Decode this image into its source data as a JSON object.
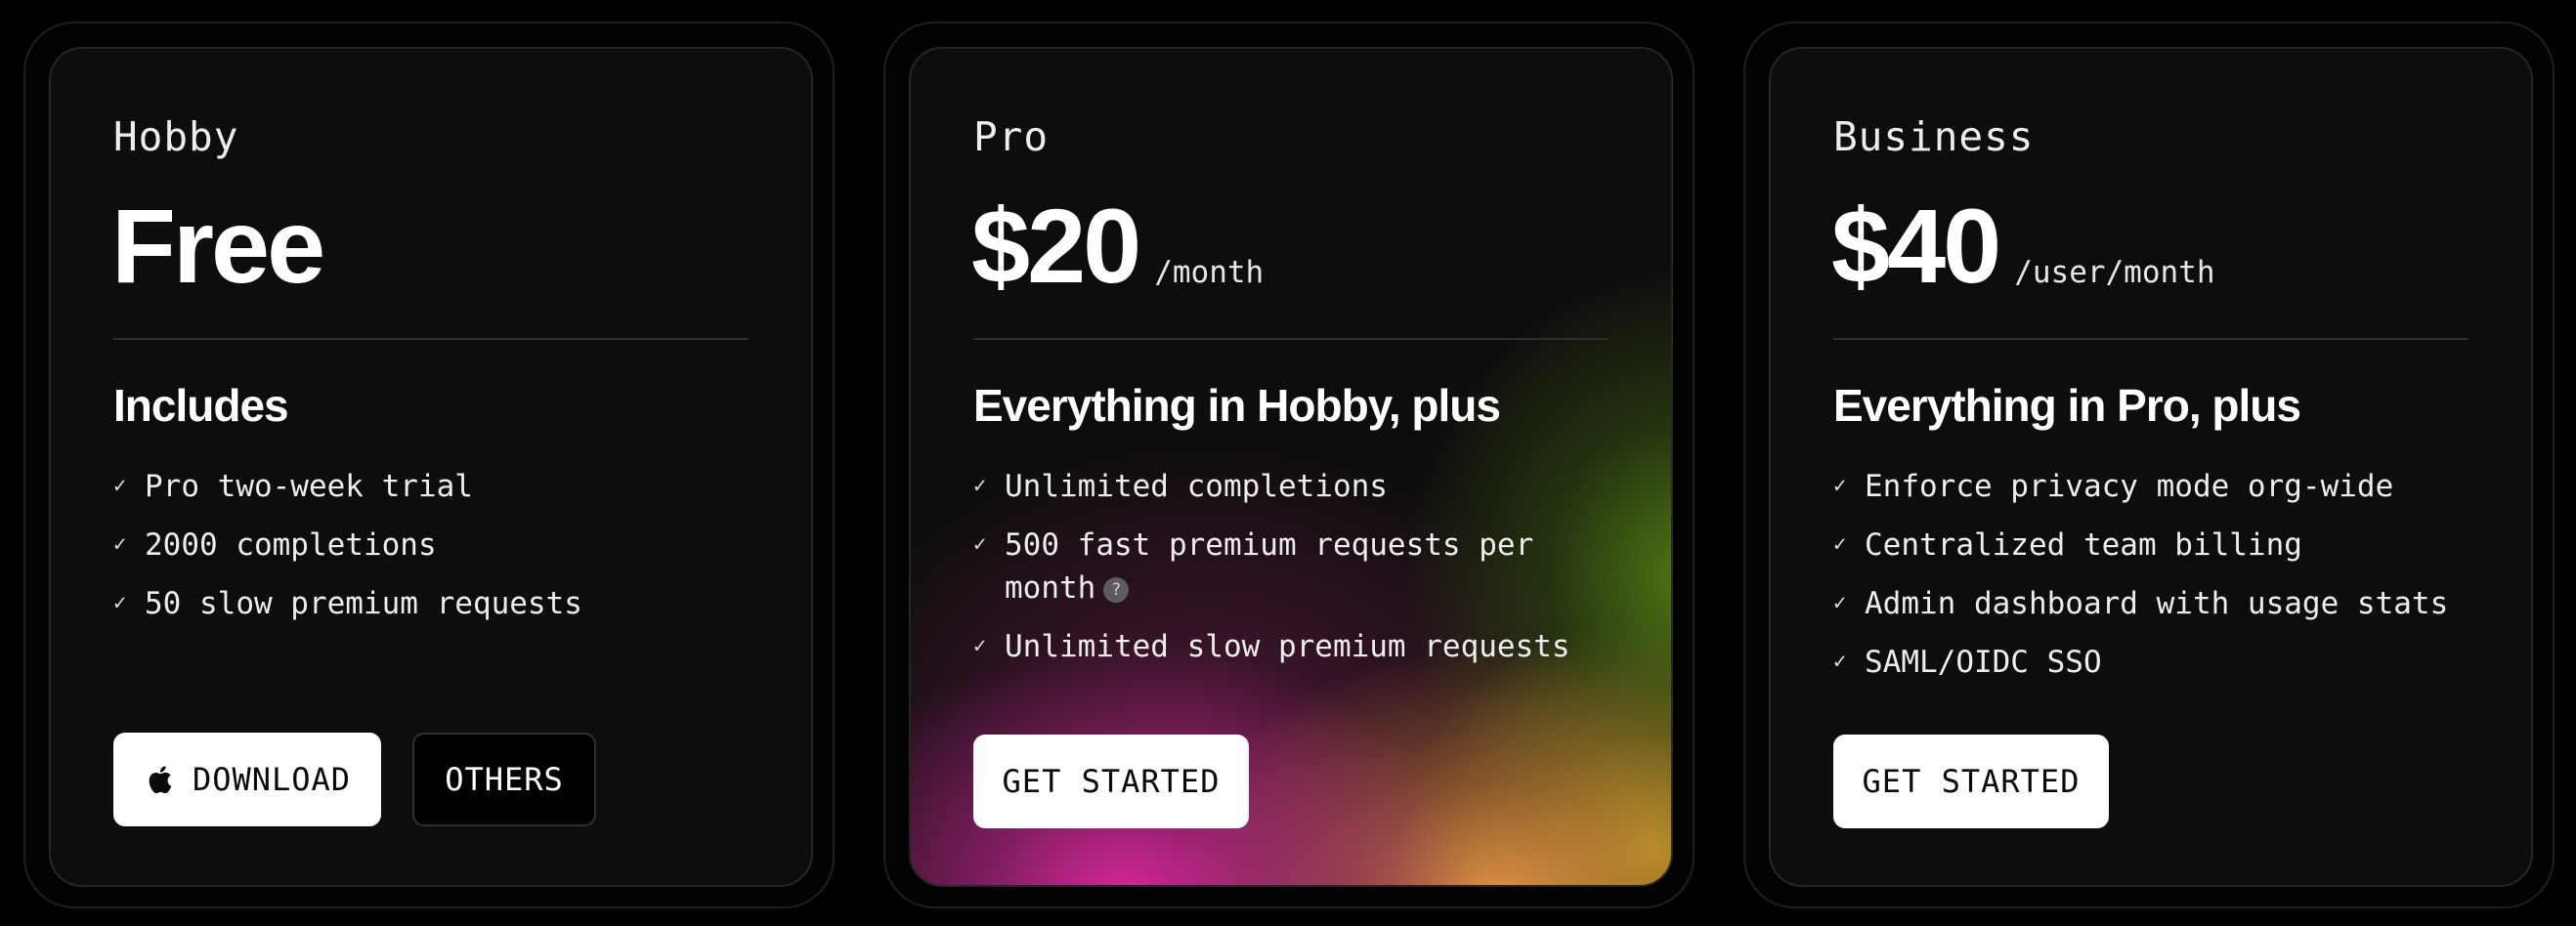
{
  "plans": [
    {
      "name": "Hobby",
      "price": "Free",
      "period": "",
      "section_title": "Includes",
      "features": [
        "Pro two-week trial",
        "2000 completions",
        "50 slow premium requests"
      ],
      "buttons": [
        {
          "label": "DOWNLOAD",
          "icon": "apple-icon",
          "style": "light"
        },
        {
          "label": "OTHERS",
          "style": "dark"
        }
      ]
    },
    {
      "name": "Pro",
      "price": "$20",
      "period": "/month",
      "section_title": "Everything in Hobby, plus",
      "features": [
        "Unlimited completions",
        "500 fast premium requests per month",
        "Unlimited slow premium requests"
      ],
      "help_icon": "?",
      "buttons": [
        {
          "label": "GET STARTED",
          "style": "light"
        }
      ]
    },
    {
      "name": "Business",
      "price": "$40",
      "period": "/user/month",
      "section_title": "Everything in Pro, plus",
      "features": [
        "Enforce privacy mode org-wide",
        "Centralized team billing",
        "Admin dashboard with usage stats",
        "SAML/OIDC SSO"
      ],
      "buttons": [
        {
          "label": "GET STARTED",
          "style": "light"
        }
      ]
    }
  ],
  "check_glyph": "✓",
  "colors": {
    "background": "#000000",
    "card": "#0d0d0d",
    "button_light": "#ffffff",
    "button_dark": "#000000",
    "gradient_magenta": "#e228a0",
    "gradient_orange": "#e89646",
    "gradient_green": "#5a8c14"
  }
}
